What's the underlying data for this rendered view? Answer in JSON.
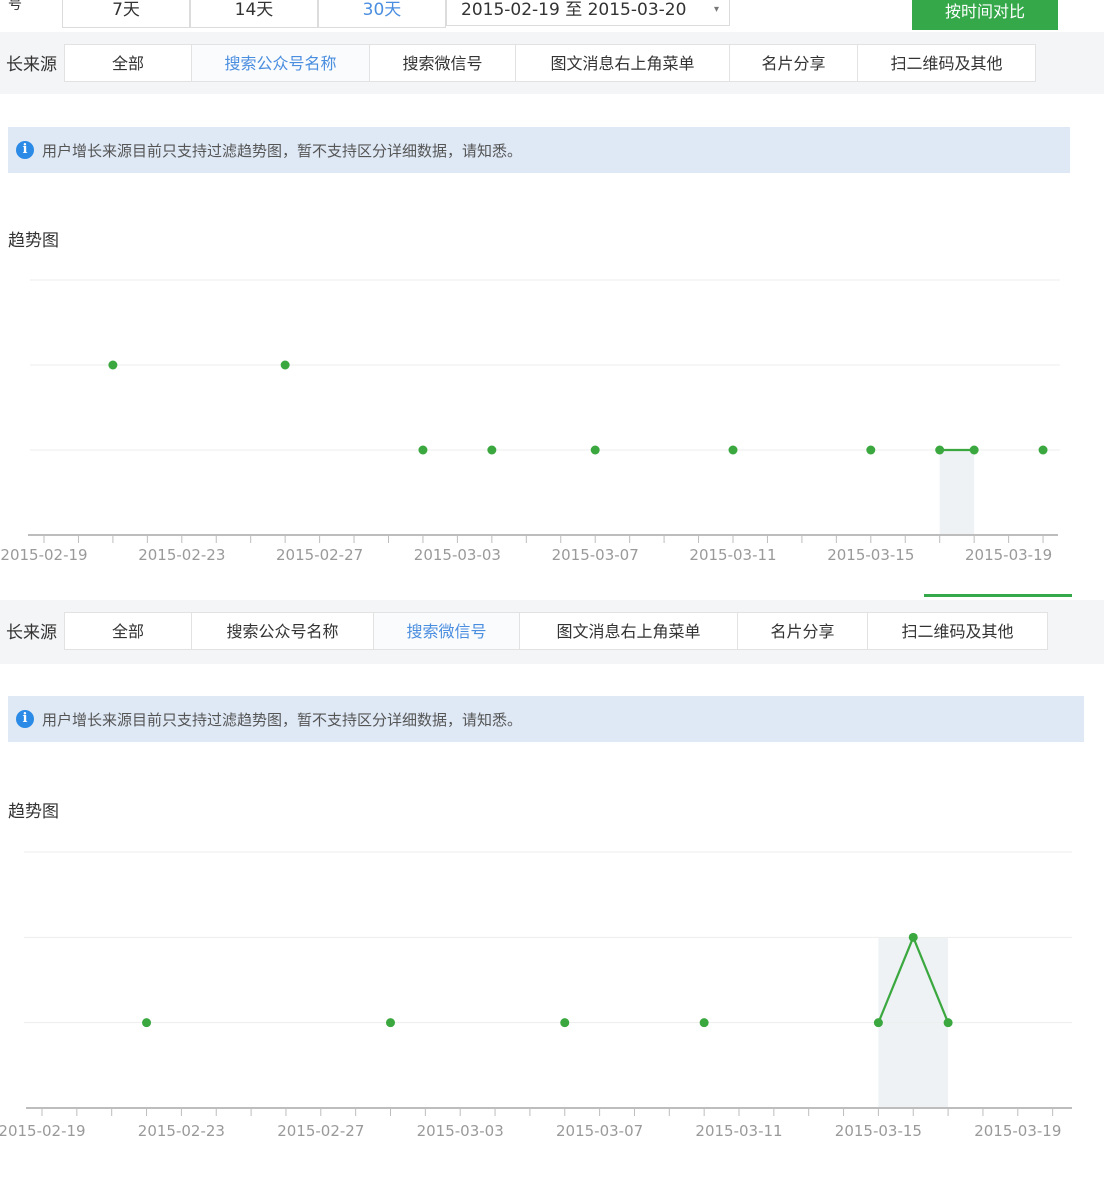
{
  "top": {
    "label": "号",
    "range_7": "7天",
    "range_14": "14天",
    "range_30": "30天",
    "date_range": "2015-02-19 至 2015-03-20",
    "compare_button": "按时间对比"
  },
  "panel1": {
    "source_label": "长来源",
    "tabs": [
      "全部",
      "搜索公众号名称",
      "搜索微信号",
      "图文消息右上角菜单",
      "名片分享",
      "扫二维码及其他"
    ],
    "active_tab": "搜索公众号名称",
    "notice": "用户增长来源目前只支持过滤趋势图，暂不支持区分详细数据，请知悉。",
    "section_title": "趋势图"
  },
  "panel2": {
    "source_label": "长来源",
    "tabs": [
      "全部",
      "搜索公众号名称",
      "搜索微信号",
      "图文消息右上角菜单",
      "名片分享",
      "扫二维码及其他"
    ],
    "active_tab": "搜索微信号",
    "notice": "用户增长来源目前只支持过滤趋势图，暂不支持区分详细数据，请知悉。",
    "section_title": "趋势图"
  },
  "colors": {
    "accent": "#35a84a",
    "active_tab": "#4a8ee0",
    "notice_bg": "#dfe9f6",
    "info_icon": "#2a8ae6"
  },
  "chart_data": [
    {
      "type": "line",
      "x_tick_labels": [
        "2015-02-19",
        "2015-02-23",
        "2015-02-27",
        "2015-03-03",
        "2015-03-07",
        "2015-03-11",
        "2015-03-15",
        "2015-03-19"
      ],
      "ylim": [
        0,
        3
      ],
      "grid": true,
      "series": [
        {
          "points": [
            {
              "x": "2015-02-21",
              "y": 2
            },
            {
              "x": "2015-02-26",
              "y": 2
            },
            {
              "x": "2015-03-02",
              "y": 1
            },
            {
              "x": "2015-03-04",
              "y": 1
            },
            {
              "x": "2015-03-07",
              "y": 1
            },
            {
              "x": "2015-03-11",
              "y": 1
            },
            {
              "x": "2015-03-15",
              "y": 1
            },
            {
              "x": "2015-03-17",
              "y": 1
            },
            {
              "x": "2015-03-18",
              "y": 1
            },
            {
              "x": "2015-03-20",
              "y": 1
            }
          ]
        }
      ],
      "highlight_range": [
        "2015-03-17",
        "2015-03-18"
      ]
    },
    {
      "type": "line",
      "x_tick_labels": [
        "2015-02-19",
        "2015-02-23",
        "2015-02-27",
        "2015-03-03",
        "2015-03-07",
        "2015-03-11",
        "2015-03-15",
        "2015-03-19"
      ],
      "ylim": [
        0,
        3
      ],
      "grid": true,
      "series": [
        {
          "points": [
            {
              "x": "2015-02-22",
              "y": 1
            },
            {
              "x": "2015-03-01",
              "y": 1
            },
            {
              "x": "2015-03-06",
              "y": 1
            },
            {
              "x": "2015-03-10",
              "y": 1
            },
            {
              "x": "2015-03-15",
              "y": 1
            },
            {
              "x": "2015-03-16",
              "y": 2
            },
            {
              "x": "2015-03-17",
              "y": 1
            }
          ]
        }
      ],
      "highlight_range": [
        "2015-03-15",
        "2015-03-17"
      ]
    }
  ]
}
